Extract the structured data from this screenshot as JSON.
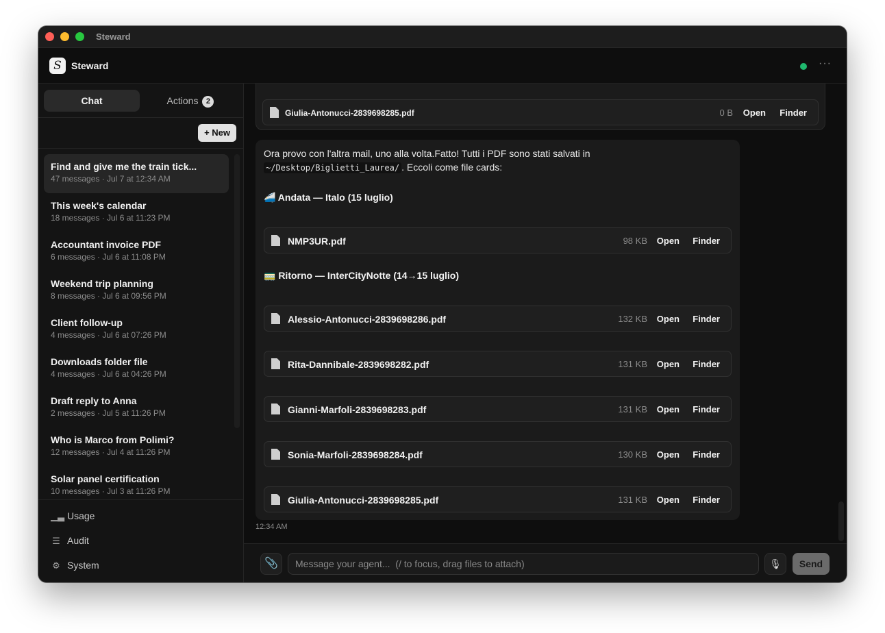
{
  "window": {
    "title": "Steward"
  },
  "header": {
    "app_name": "Steward",
    "logo_glyph": "S",
    "status_color": "#1fb86e",
    "more_label": "···"
  },
  "sidebar": {
    "tabs": [
      {
        "label": "Chat",
        "active": true
      },
      {
        "label": "Actions",
        "badge": "2"
      }
    ],
    "new_button": "+ New",
    "conversations": [
      {
        "title": "Find and give me the train tick...",
        "meta": "47 messages · Jul 7 at 12:34 AM",
        "active": true
      },
      {
        "title": "This week's calendar",
        "meta": "18 messages · Jul 6 at 11:23 PM"
      },
      {
        "title": "Accountant invoice PDF",
        "meta": "6 messages · Jul 6 at 11:08 PM"
      },
      {
        "title": "Weekend trip planning",
        "meta": "8 messages · Jul 6 at 09:56 PM"
      },
      {
        "title": "Client follow-up",
        "meta": "4 messages · Jul 6 at 07:26 PM"
      },
      {
        "title": "Downloads folder file",
        "meta": "4 messages · Jul 6 at 04:26 PM"
      },
      {
        "title": "Draft reply to Anna",
        "meta": "2 messages · Jul 5 at 11:26 PM"
      },
      {
        "title": "Who is Marco from Polimi?",
        "meta": "12 messages · Jul 4 at 11:26 PM"
      },
      {
        "title": "Solar panel certification",
        "meta": "10 messages · Jul 3 at 11:26 PM"
      }
    ],
    "nav": [
      {
        "label": "Usage",
        "icon": "bar-chart-icon"
      },
      {
        "label": "Audit",
        "icon": "checklist-icon"
      },
      {
        "label": "System",
        "icon": "gear-icon"
      }
    ]
  },
  "main": {
    "previous_card": {
      "file": {
        "name": "Giulia-Antonucci-2839698285.pdf",
        "size": "0 B",
        "open": "Open",
        "finder": "Finder"
      }
    },
    "message": {
      "text_before": "Ora provo con l'altra mail, uno alla volta.Fatto! Tutti i PDF sono stati salvati in",
      "path": "~/Desktop/Biglietti_Laurea/",
      "text_after": ". Eccoli come file cards:",
      "section_outbound": "🚄 Andata — Italo (15 luglio)",
      "section_return": "🚃 Ritorno — InterCityNotte (14→15 luglio)",
      "outbound_files": [
        {
          "name": "NMP3UR.pdf",
          "size": "98 KB",
          "open": "Open",
          "finder": "Finder"
        }
      ],
      "return_files": [
        {
          "name": "Alessio-Antonucci-2839698286.pdf",
          "size": "132 KB",
          "open": "Open",
          "finder": "Finder"
        },
        {
          "name": "Rita-Dannibale-2839698282.pdf",
          "size": "131 KB",
          "open": "Open",
          "finder": "Finder"
        },
        {
          "name": "Gianni-Marfoli-2839698283.pdf",
          "size": "131 KB",
          "open": "Open",
          "finder": "Finder"
        },
        {
          "name": "Sonia-Marfoli-2839698284.pdf",
          "size": "130 KB",
          "open": "Open",
          "finder": "Finder"
        },
        {
          "name": "Giulia-Antonucci-2839698285.pdf",
          "size": "131 KB",
          "open": "Open",
          "finder": "Finder"
        }
      ],
      "timestamp": "12:34 AM"
    }
  },
  "composer": {
    "placeholder": "Message your agent...  (/ to focus, drag files to attach)",
    "send_label": "Send"
  }
}
